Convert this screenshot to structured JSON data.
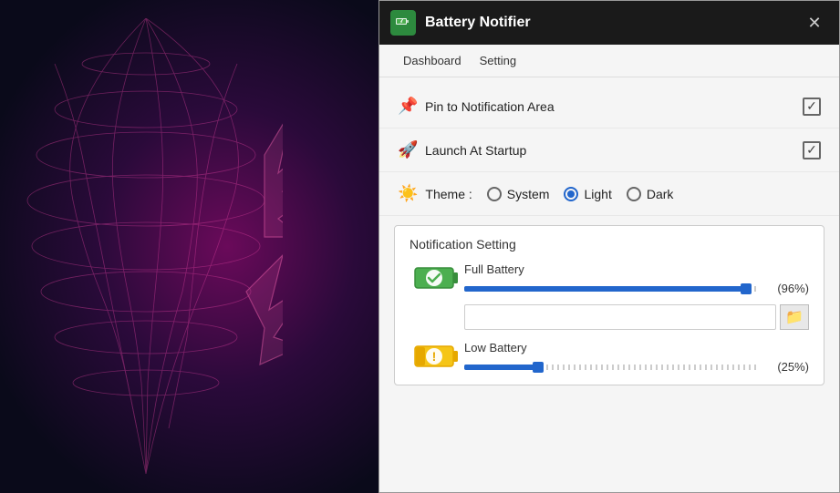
{
  "background": {
    "color": "#1a0a1a"
  },
  "window": {
    "title": "Battery Notifier",
    "icon": "🔋",
    "close_label": "✕"
  },
  "menu": {
    "items": [
      "Dashboard",
      "Setting"
    ]
  },
  "settings": {
    "pin_label": "Pin to Notification Area",
    "pin_checked": true,
    "pin_icon": "📌",
    "launch_label": "Launch At Startup",
    "launch_checked": true,
    "launch_icon": "🚀",
    "theme_icon": "☀",
    "theme_label": "Theme :",
    "theme_options": [
      "System",
      "Light",
      "Dark"
    ],
    "theme_selected": "Light"
  },
  "notification": {
    "title": "Notification Setting",
    "full_battery": {
      "name": "Full Battery",
      "value_percent": 96,
      "value_label": "(96%)",
      "fill_pct": 96
    },
    "low_battery": {
      "name": "Low Battery",
      "value_percent": 25,
      "value_label": "(25%)",
      "fill_pct": 25
    }
  },
  "icons": {
    "full_battery_emoji": "🔋✅",
    "low_battery_emoji": "🪫",
    "folder_emoji": "📁"
  }
}
